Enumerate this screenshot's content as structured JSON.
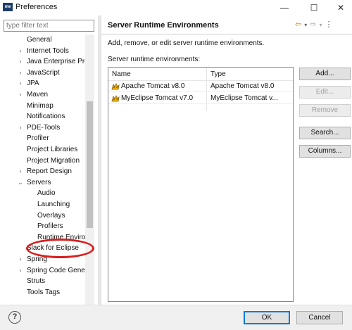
{
  "window": {
    "title": "Preferences",
    "icon_text": "me",
    "minimize": "—",
    "maximize": "☐",
    "close": "✕"
  },
  "sidebar": {
    "filter_placeholder": "type filter text",
    "items": [
      {
        "label": "General",
        "level": 1,
        "arrow": ""
      },
      {
        "label": "Internet Tools",
        "level": 1,
        "arrow": "›"
      },
      {
        "label": "Java Enterprise Pro",
        "level": 1,
        "arrow": "›"
      },
      {
        "label": "JavaScript",
        "level": 1,
        "arrow": "›"
      },
      {
        "label": "JPA",
        "level": 1,
        "arrow": "›"
      },
      {
        "label": "Maven",
        "level": 1,
        "arrow": "›"
      },
      {
        "label": "Minimap",
        "level": 1,
        "arrow": ""
      },
      {
        "label": "Notifications",
        "level": 1,
        "arrow": ""
      },
      {
        "label": "PDE-Tools",
        "level": 1,
        "arrow": "›"
      },
      {
        "label": "Profiler",
        "level": 1,
        "arrow": ""
      },
      {
        "label": "Project Libraries",
        "level": 1,
        "arrow": ""
      },
      {
        "label": "Project Migration",
        "level": 1,
        "arrow": ""
      },
      {
        "label": "Report Design",
        "level": 1,
        "arrow": "›"
      },
      {
        "label": "Servers",
        "level": 1,
        "arrow": "⌄"
      },
      {
        "label": "Audio",
        "level": 2,
        "arrow": ""
      },
      {
        "label": "Launching",
        "level": 2,
        "arrow": ""
      },
      {
        "label": "Overlays",
        "level": 2,
        "arrow": ""
      },
      {
        "label": "Profilers",
        "level": 2,
        "arrow": ""
      },
      {
        "label": "Runtime Enviro",
        "level": 2,
        "arrow": "",
        "selected": true
      },
      {
        "label": "Slack for Eclipse",
        "level": 1,
        "arrow": ""
      },
      {
        "label": "Spring",
        "level": 1,
        "arrow": "›"
      },
      {
        "label": "Spring Code Gene",
        "level": 1,
        "arrow": "›"
      },
      {
        "label": "Struts",
        "level": 1,
        "arrow": ""
      },
      {
        "label": "Tools Tags",
        "level": 1,
        "arrow": ""
      }
    ]
  },
  "page": {
    "title": "Server Runtime Environments",
    "description": "Add, remove, or edit server runtime environments.",
    "table_label": "Server runtime environments:",
    "nav_icons": [
      "back-icon",
      "back-menu-icon",
      "forward-icon",
      "forward-menu-icon",
      "more-icon"
    ],
    "columns": [
      "Name",
      "Type"
    ],
    "rows": [
      {
        "name": "Apache Tomcat v8.0",
        "type": "Apache Tomcat v8.0"
      },
      {
        "name": "MyEclipse Tomcat v7.0",
        "type": "MyEclipse Tomcat v..."
      }
    ],
    "buttons": {
      "add": "Add...",
      "edit": "Edit...",
      "remove": "Remove",
      "search": "Search...",
      "columns": "Columns..."
    }
  },
  "footer": {
    "help": "?",
    "ok": "OK",
    "cancel": "Cancel"
  },
  "colors": {
    "accent": "#0078d7",
    "highlight_oval": "#d6201f",
    "nav_arrow": "#d08a00"
  }
}
